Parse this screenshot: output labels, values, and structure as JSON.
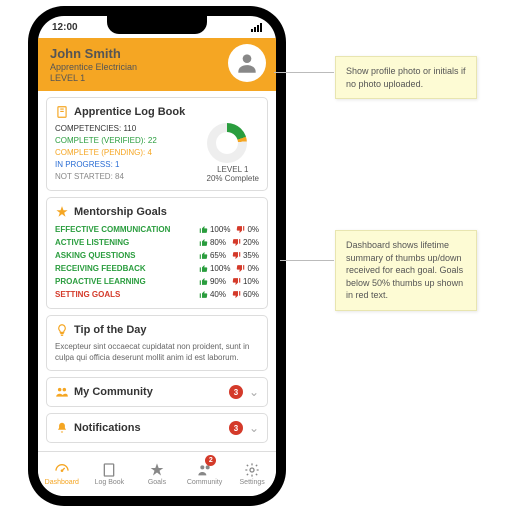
{
  "status": {
    "time": "12:00"
  },
  "user": {
    "name": "John Smith",
    "role": "Apprentice Electrician",
    "level": "LEVEL 1"
  },
  "logbook": {
    "title": "Apprentice Log Book",
    "competencies": "COMPETENCIES: 110",
    "verified": "COMPLETE (VERIFIED): 22",
    "pending": "COMPLETE (PENDING): 4",
    "inprogress": "IN PROGRESS: 1",
    "notstarted": "NOT STARTED: 84",
    "chartLevel": "LEVEL 1",
    "chartPct": "20% Complete"
  },
  "mentorship": {
    "title": "Mentorship Goals",
    "goals": [
      {
        "name": "EFFECTIVE COMMUNICATION",
        "up": "100%",
        "down": "0%",
        "bad": false
      },
      {
        "name": "ACTIVE LISTENING",
        "up": "80%",
        "down": "20%",
        "bad": false
      },
      {
        "name": "ASKING QUESTIONS",
        "up": "65%",
        "down": "35%",
        "bad": false
      },
      {
        "name": "RECEIVING FEEDBACK",
        "up": "100%",
        "down": "0%",
        "bad": false
      },
      {
        "name": "PROACTIVE LEARNING",
        "up": "90%",
        "down": "10%",
        "bad": false
      },
      {
        "name": "SETTING GOALS",
        "up": "40%",
        "down": "60%",
        "bad": true
      }
    ]
  },
  "tip": {
    "title": "Tip of the Day",
    "text": "Excepteur sint occaecat cupidatat non proident, sunt in culpa qui officia deserunt mollit anim id est laborum."
  },
  "community": {
    "title": "My Community",
    "badge": "3"
  },
  "notifications": {
    "title": "Notifications",
    "badge": "3"
  },
  "tabs": {
    "dashboard": "Dashboard",
    "logbook": "Log Book",
    "goals": "Goals",
    "community": "Community",
    "settings": "Settings",
    "commBadge": "2"
  },
  "notes": {
    "avatar": "Show profile photo or initials if no photo uploaded.",
    "goals": "Dashboard shows lifetime summary of thumbs up/down received for each goal. Goals below 50% thumbs up shown in red text."
  },
  "chart_data": {
    "type": "pie",
    "title": "LEVEL 1 — 20% Complete",
    "categories": [
      "Complete (Verified)",
      "Complete (Pending)",
      "In Progress",
      "Not Started"
    ],
    "values": [
      22,
      4,
      1,
      84
    ]
  }
}
